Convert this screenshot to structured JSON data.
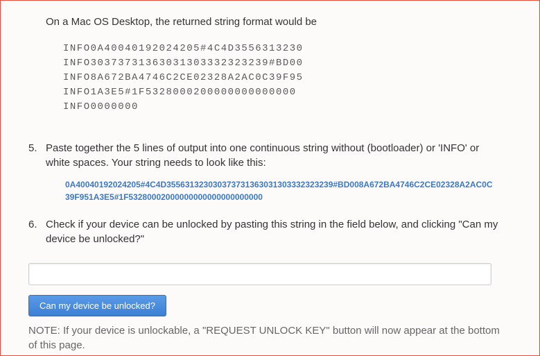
{
  "intro": "On a Mac OS Desktop, the returned string format would be",
  "code_lines": [
    "INFO0A40040192024205#4C4D3556313230",
    "INFO30373731363031303332323239#BD00",
    "INFO8A672BA4746C2CE02328A2AC0C39F95",
    "INFO1A3E5#1F5328000200000000000000",
    "INFO0000000"
  ],
  "step5": "Paste together the 5 lines of output into one continuous string without (bootloader) or 'INFO' or white spaces. Your string needs to look like this:",
  "hex_string": "0A40040192024205#4C4D355631323030373731363031303332323239#BD008A672BA4746C2CE02328A2AC0C39F951A3E5#1F53280002000000000000000000000",
  "step6": "Check if your device can be unlocked by pasting this string in the field below, and clicking \"Can my device be unlocked?\"",
  "button_label": "Can my device be unlocked?",
  "note": "NOTE: If your device is unlockable, a \"REQUEST UNLOCK KEY\" button will now appear at the bottom of this page."
}
